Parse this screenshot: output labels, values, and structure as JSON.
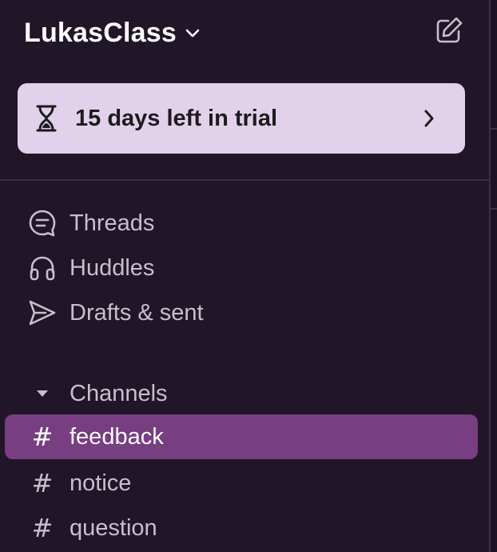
{
  "workspace": {
    "name": "LukasClass",
    "menu_icon": "chevron-down-icon",
    "compose_icon": "compose-icon"
  },
  "trial": {
    "text": "15 days left in trial",
    "icon": "hourglass-icon",
    "chevron_icon": "chevron-right-icon"
  },
  "nav": {
    "items": [
      {
        "label": "Threads",
        "icon": "threads-icon"
      },
      {
        "label": "Huddles",
        "icon": "headphones-icon"
      },
      {
        "label": "Drafts & sent",
        "icon": "send-icon"
      }
    ]
  },
  "channels": {
    "header": "Channels",
    "toggle_icon": "caret-down-icon",
    "items": [
      {
        "name": "feedback",
        "active": true
      },
      {
        "name": "notice",
        "active": false
      },
      {
        "name": "question",
        "active": false
      }
    ],
    "prefix": "#"
  },
  "colors": {
    "sidebar_bg": "#201628",
    "active_channel": "#773e82",
    "trial_bg": "#e1d1ea",
    "text_muted": "#c7bfcc"
  }
}
